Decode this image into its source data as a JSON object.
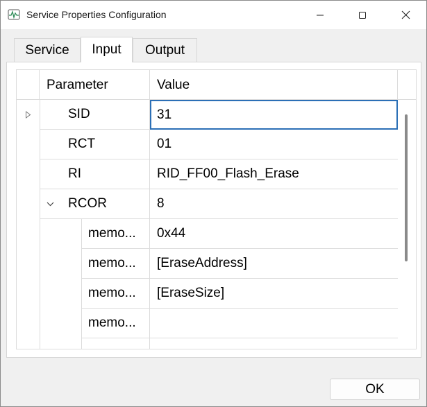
{
  "window": {
    "title": "Service Properties Configuration",
    "icon": "waveform-app-icon"
  },
  "tabs": [
    {
      "label": "Service",
      "active": false
    },
    {
      "label": "Input",
      "active": true
    },
    {
      "label": "Output",
      "active": false
    }
  ],
  "grid": {
    "columns": {
      "parameter": "Parameter",
      "value": "Value"
    },
    "rows": [
      {
        "param": "SID",
        "value": "31",
        "level": 0,
        "expander": "collapsed",
        "selected": true
      },
      {
        "param": "RCT",
        "value": "01",
        "level": 0
      },
      {
        "param": "RI",
        "value": "RID_FF00_Flash_Erase",
        "level": 0
      },
      {
        "param": "RCOR",
        "value": "8",
        "level": 0,
        "expander": "expanded"
      },
      {
        "param": "memo...",
        "value": "0x44",
        "level": 1
      },
      {
        "param": "memo...",
        "value": "[EraseAddress]",
        "level": 1
      },
      {
        "param": "memo...",
        "value": "[EraseSize]",
        "level": 1
      },
      {
        "param": "memo...",
        "value": "",
        "level": 1
      }
    ]
  },
  "buttons": {
    "ok": "OK"
  },
  "colors": {
    "selection_border": "#2b6fb6",
    "window_bg": "#f0f0f0",
    "grid_line": "#dcdcdc"
  }
}
